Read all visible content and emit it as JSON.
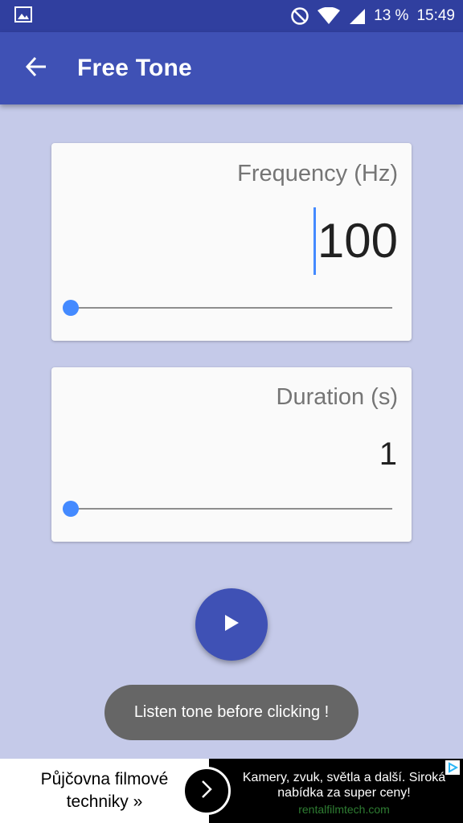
{
  "status_bar": {
    "battery": "13 %",
    "time": "15:49",
    "icons": [
      "image-notification-icon",
      "dnd-icon",
      "wifi-icon",
      "signal-icon"
    ]
  },
  "app_bar": {
    "title": "Free Tone",
    "back_icon": "arrow-back-icon"
  },
  "frequency": {
    "label": "Frequency (Hz)",
    "value": "100",
    "slider_fraction": 0.0
  },
  "duration": {
    "label": "Duration (s)",
    "value": "1",
    "slider_fraction": 0.0
  },
  "play_button": {
    "icon": "play-icon"
  },
  "toast": {
    "text": "Listen tone before clicking !"
  },
  "ad": {
    "left_text_line1": "Půjčovna filmové",
    "left_text_line2": "techniky »",
    "right_text": "Kamery, zvuk, světla a další. Siroká nabídka za super ceny!",
    "url": "rentalfilmtech.com"
  },
  "colors": {
    "primary": "#3f51b5",
    "primary_dark": "#303f9f",
    "background": "#c5cae9",
    "accent": "#448aff"
  }
}
